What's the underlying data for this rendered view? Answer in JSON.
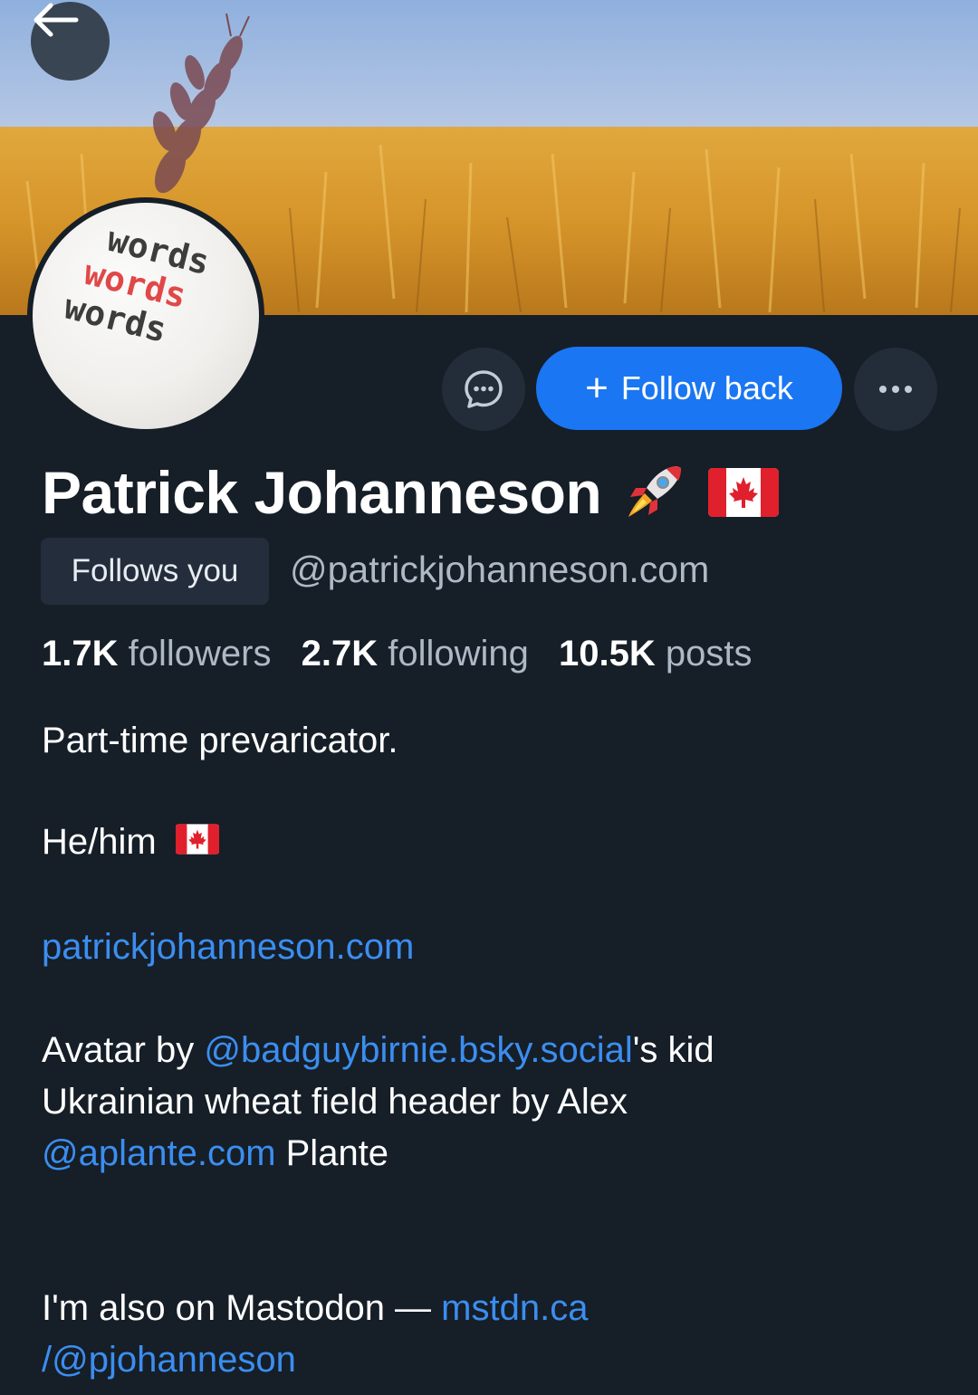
{
  "header": {
    "back_icon": "arrow-left-icon"
  },
  "avatar": {
    "words": [
      "words",
      "words",
      "words"
    ]
  },
  "actions": {
    "message_icon": "chat-bubble-icon",
    "follow_label": "Follow back",
    "more_icon": "more-dots-icon",
    "follow_color": "#1a76f2"
  },
  "profile": {
    "display_name": "Patrick Johanneson",
    "name_emojis": [
      "rocket-emoji",
      "canada-flag-emoji"
    ],
    "follows_you_badge": "Follows you",
    "handle": "@patrickjohanneson.com"
  },
  "stats": {
    "followers_count": "1.7K",
    "followers_label": "followers",
    "following_count": "2.7K",
    "following_label": "following",
    "posts_count": "10.5K",
    "posts_label": "posts"
  },
  "bio": {
    "line1": "Part-time prevaricator.",
    "line2": "He/him",
    "website": "patrickjohanneson.com",
    "avatar_credit_prefix": "Avatar by ",
    "avatar_credit_link": "@badguybirnie.bsky.social",
    "avatar_credit_suffix": "'s kid",
    "header_credit": "Ukrainian wheat field header by Alex",
    "header_credit_link": "@aplante.com",
    "header_credit_suffix": " Plante",
    "mastodon_prefix": "I'm also on Mastodon — ",
    "mastodon_link_part1": "mstdn.ca",
    "mastodon_link_part2": "/@pjohanneson"
  },
  "colors": {
    "background": "#161e27",
    "link": "#3b8ef0",
    "muted": "#aeb9c6"
  }
}
